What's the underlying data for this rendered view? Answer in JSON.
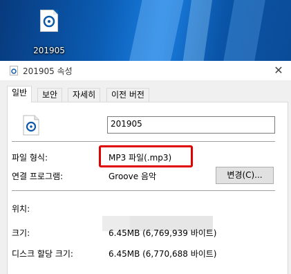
{
  "desktop": {
    "icon_label": "201905"
  },
  "dialog": {
    "title": "201905 속성",
    "close_glyph": "✕",
    "tabs": [
      {
        "label": "일반"
      },
      {
        "label": "보안"
      },
      {
        "label": "자세히"
      },
      {
        "label": "이전 버전"
      }
    ],
    "file_name": "201905",
    "rows": {
      "type_label": "파일 형식:",
      "type_value": "MP3 파일(.mp3)",
      "opens_label": "연결 프로그램:",
      "opens_value": "Groove 음악",
      "change_button": "변경(C)...",
      "location_label": "위치:",
      "size_label": "크기:",
      "size_value": "6.45MB (6,769,939 바이트)",
      "disk_label": "디스크 할당 크기:",
      "disk_value": "6.45MB (6,770,688 바이트)"
    }
  },
  "colors": {
    "highlight": "#e00000",
    "accent": "#0c5aa8"
  },
  "icons": [
    "groove-music-file-icon",
    "close-icon"
  ]
}
